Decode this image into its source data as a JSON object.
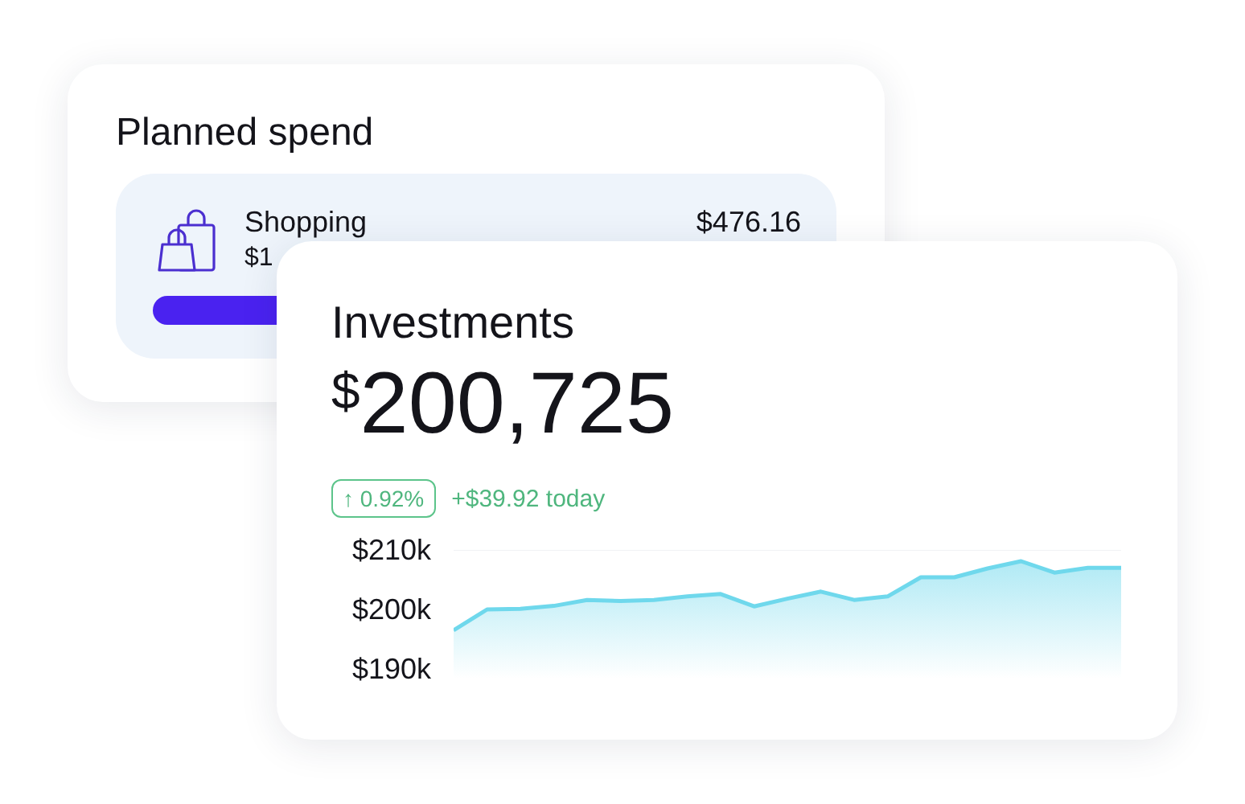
{
  "planned_spend": {
    "title": "Planned spend",
    "item": {
      "name": "Shopping",
      "amount": "$476.16",
      "subtitle": "$1"
    }
  },
  "investments": {
    "title": "Investments",
    "currency": "$",
    "total": "200,725",
    "change_icon": "↑",
    "change_percent": "0.92%",
    "change_today": "+$39.92 today",
    "chart_data": {
      "type": "area",
      "ylim": [
        190,
        210
      ],
      "yticks": [
        {
          "value": 210,
          "label": "$210k"
        },
        {
          "value": 200,
          "label": "$200k"
        },
        {
          "value": 190,
          "label": "$190k"
        }
      ],
      "series": [
        {
          "color": "#6fd8ec",
          "values": [
            196.5,
            200.0,
            200.1,
            200.6,
            201.6,
            201.4,
            201.6,
            202.2,
            202.6,
            200.5,
            201.8,
            203.0,
            201.6,
            202.2,
            205.4,
            205.4,
            206.9,
            208.1,
            206.2,
            207,
            207
          ]
        }
      ]
    }
  }
}
